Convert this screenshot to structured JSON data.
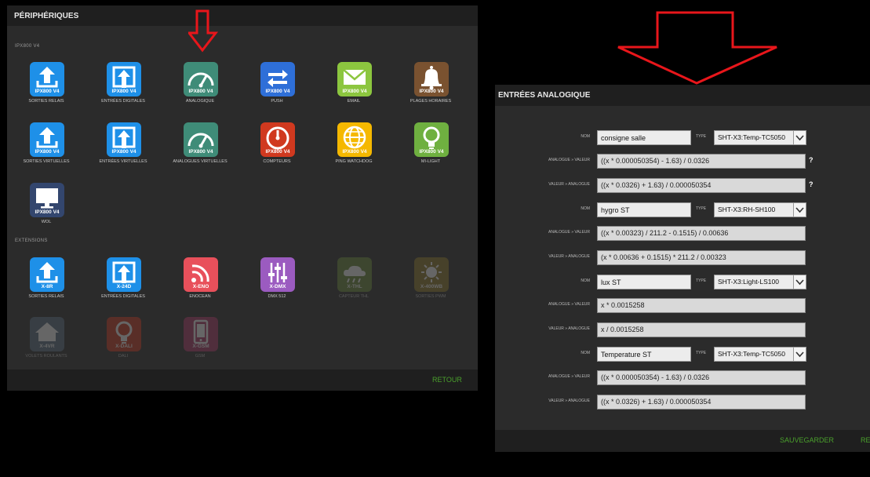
{
  "left_panel": {
    "title": "PÉRIPHÉRIQUES",
    "sections": [
      {
        "label": "IPX800 V4"
      },
      {
        "label": "EXTENSIONS"
      }
    ],
    "ipx_tiles": [
      {
        "tag": "IPX800 V4",
        "label": "SORTIES RELAIS",
        "icon": "upload-arrow-icon",
        "color": "#1e90e8"
      },
      {
        "tag": "IPX800 V4",
        "label": "ENTRÉES DIGITALES",
        "icon": "input-arrow-icon",
        "color": "#1e90e8"
      },
      {
        "tag": "IPX800 V4",
        "label": "ANALOGIQUE",
        "icon": "gauge-icon",
        "color": "#3f8c78"
      },
      {
        "tag": "IPX800 V4",
        "label": "PUSH",
        "icon": "push-arrows-icon",
        "color": "#2e6fd8"
      },
      {
        "tag": "IPX800 V4",
        "label": "EMAIL",
        "icon": "envelope-icon",
        "color": "#8cc63f"
      },
      {
        "tag": "IPX800 V4",
        "label": "PLAGES HORAIRES",
        "icon": "bell-icon",
        "color": "#7a5230"
      },
      {
        "tag": "IPX800 V4",
        "label": "SORTIES VIRTUELLES",
        "icon": "upload-arrow-icon",
        "color": "#1e90e8"
      },
      {
        "tag": "IPX800 V4",
        "label": "ENTRÉES VIRTUELLES",
        "icon": "input-arrow-icon",
        "color": "#1e90e8"
      },
      {
        "tag": "IPX800 V4",
        "label": "ANALOGUES VIRTUELLES",
        "icon": "gauge-icon",
        "color": "#3f8c78"
      },
      {
        "tag": "IPX800 V4",
        "label": "COMPTEURS",
        "icon": "counter-dial-icon",
        "color": "#d0391f"
      },
      {
        "tag": "IPX800 V4",
        "label": "PING WATCHDOG",
        "icon": "globe-icon",
        "color": "#f5b800"
      },
      {
        "tag": "IPX800 V4",
        "label": "MI-LIGHT",
        "icon": "lightbulb-icon",
        "color": "#6fb040"
      },
      {
        "tag": "IPX800 V4",
        "label": "WOL",
        "icon": "monitor-icon",
        "color": "#33466e"
      }
    ],
    "ext_tiles": [
      {
        "tag": "X-8R",
        "label": "SORTIES RELAIS",
        "icon": "upload-arrow-icon",
        "color": "#1e90e8"
      },
      {
        "tag": "X-24D",
        "label": "ENTRÉES DIGITALES",
        "icon": "input-arrow-icon",
        "color": "#1e90e8"
      },
      {
        "tag": "X-ENO",
        "label": "ENOCEAN",
        "icon": "wifi-signal-icon",
        "color": "#e8505b"
      },
      {
        "tag": "X-DMX",
        "label": "DMX 512",
        "icon": "sliders-icon",
        "color": "#9b5bc0"
      },
      {
        "tag": "X-THL",
        "label": "CAPTEUR THL",
        "icon": "weather-cloud-icon",
        "color": "#6b8e3a"
      },
      {
        "tag": "X-400WB",
        "label": "SORTIES PWM",
        "icon": "sun-dimmer-icon",
        "color": "#8f7a2a"
      },
      {
        "tag": "X-4VR",
        "label": "VOLETS ROULANTS",
        "icon": "house-icon",
        "color": "#5a6f84"
      },
      {
        "tag": "X-DALI",
        "label": "DALI",
        "icon": "lightbulb-icon",
        "color": "#d0391f"
      },
      {
        "tag": "X-GSM",
        "label": "GSM",
        "icon": "phone-icon",
        "color": "#b0386a"
      }
    ],
    "back_label": "RETOUR"
  },
  "right_panel": {
    "title": "ENTRÉES ANALOGIQUE",
    "name_label": "NOM",
    "type_label": "TYPE",
    "a2v_label": "ANALOGUE » VALEUR",
    "v2a_label": "VALEUR » ANALOGUE",
    "help": "?",
    "entries": [
      {
        "name": "consigne salle",
        "type": "SHT-X3:Temp-TC5050",
        "a2v": "((x * 0.000050354) - 1.63) / 0.0326",
        "v2a": "((x * 0.0326) + 1.63) / 0.000050354"
      },
      {
        "name": "hygro ST",
        "type": "SHT-X3:RH-SH100",
        "a2v": "((x * 0.00323) / 211.2 - 0.1515) / 0.00636",
        "v2a": "(x * 0.00636 + 0.1515) * 211.2 / 0.00323"
      },
      {
        "name": "lux ST",
        "type": "SHT-X3:Light-LS100",
        "a2v": "x * 0.0015258",
        "v2a": "x / 0.0015258"
      },
      {
        "name": "Temperature ST",
        "type": "SHT-X3:Temp-TC5050",
        "a2v": "((x * 0.000050354) - 1.63) / 0.0326",
        "v2a": "((x * 0.0326) + 1.63) / 0.000050354"
      }
    ],
    "save_label": "SAUVEGARDER",
    "back_label": "RETOUR"
  },
  "annotations": {
    "arrow_color": "#e8161b"
  }
}
